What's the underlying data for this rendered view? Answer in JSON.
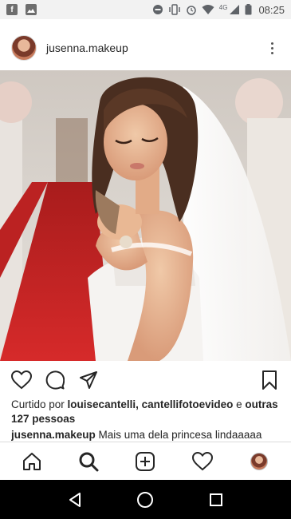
{
  "status_bar": {
    "time": "08:25",
    "network_label": "4G",
    "notification_icons": [
      "facebook-icon",
      "gallery-icon"
    ],
    "system_icons": [
      "do-not-disturb-icon",
      "vibrate-icon",
      "alarm-icon",
      "wifi-icon",
      "cellular-signal-icon",
      "battery-icon"
    ]
  },
  "post": {
    "username": "jusenna.makeup",
    "photo_description_icon": "bride-photo",
    "likes": {
      "prefix": "Curtido por ",
      "names": "louisecantelli, cantellifotoevideo",
      "connector": " e ",
      "others": "outras 127 pessoas"
    },
    "caption": {
      "username": "jusenna.makeup",
      "text": " Mais uma dela princesa lindaaaaa"
    }
  },
  "actions": {
    "icons": [
      "heart-icon",
      "comment-icon",
      "share-icon",
      "bookmark-icon"
    ]
  },
  "tab_bar": {
    "icons": [
      "home-icon",
      "search-icon",
      "add-post-icon",
      "activity-heart-icon",
      "profile-avatar"
    ]
  },
  "android_nav": {
    "icons": [
      "back-icon",
      "home-circle-icon",
      "recents-icon"
    ]
  },
  "colors": {
    "text": "#262626",
    "status_bar_bg": "#f2f2f2",
    "nav_bg": "#000000",
    "carpet_red": "#c42424"
  }
}
